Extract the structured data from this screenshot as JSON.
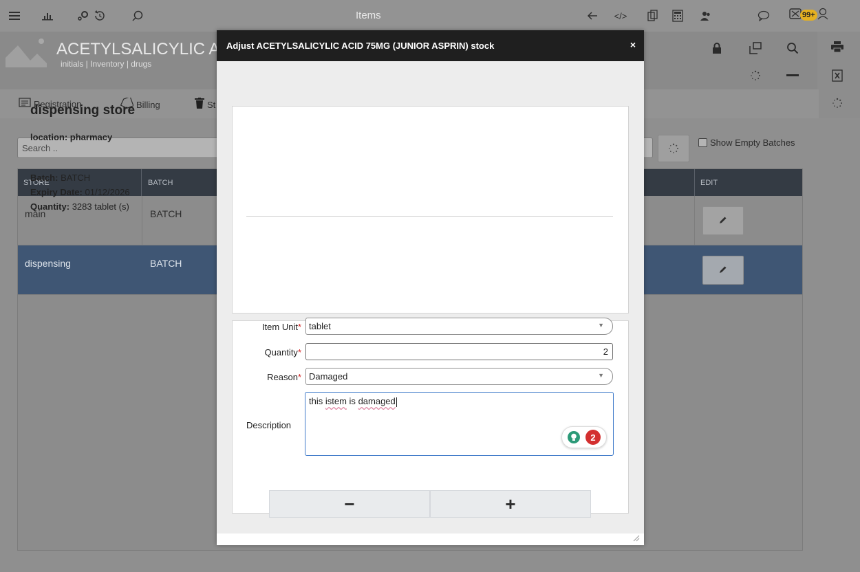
{
  "topbar": {
    "title": "Items",
    "icons": [
      "menu-icon",
      "chart-icon",
      "settings-icon",
      "history-icon",
      "search-icon",
      "back-icon",
      "code-icon",
      "copy-icon",
      "calculator-icon",
      "users-icon",
      "chat-icon",
      "mail-icon",
      "user-icon"
    ],
    "badge": "99+"
  },
  "item": {
    "name": "ACETYLSALICYLIC A",
    "subtitle": "initials | Inventory | drugs"
  },
  "nav": {
    "registration": "Registration",
    "billing": "Billing",
    "stock_prefix": "St"
  },
  "search": {
    "placeholder": "Search .."
  },
  "show_empty_batches": "Show Empty Batches",
  "table": {
    "headers": {
      "store": "STORE",
      "batch": "BATCH",
      "edit": "EDIT"
    },
    "rows": [
      {
        "store": "main",
        "batch": "BATCH",
        "selected": false
      },
      {
        "store": "dispensing",
        "batch": "BATCH",
        "selected": true
      }
    ]
  },
  "modal": {
    "title": "Adjust ACETYLSALICYLIC ACID 75MG (JUNIOR ASPRIN) stock",
    "close": "×",
    "store_name": "dispensing store",
    "location": "location: pharmacy",
    "batch_label": "Batch:",
    "batch_value": "BATCH",
    "expiry_label": "Expiry Date:",
    "expiry_value": "01/12/2026",
    "quantity_label": "Quantity:",
    "quantity_value": "3283 tablet (s)",
    "form": {
      "item_unit_label": "Item Unit",
      "item_unit_value": "tablet",
      "quantity_label": "Quantity",
      "quantity_value": "2",
      "reason_label": "Reason",
      "reason_value": "Damaged",
      "description_label": "Description",
      "description_parts": [
        "this",
        "istem",
        "is",
        "damaged"
      ],
      "required_mark": "*",
      "suggestion_count": "2"
    },
    "minus": "−",
    "plus": "+"
  }
}
